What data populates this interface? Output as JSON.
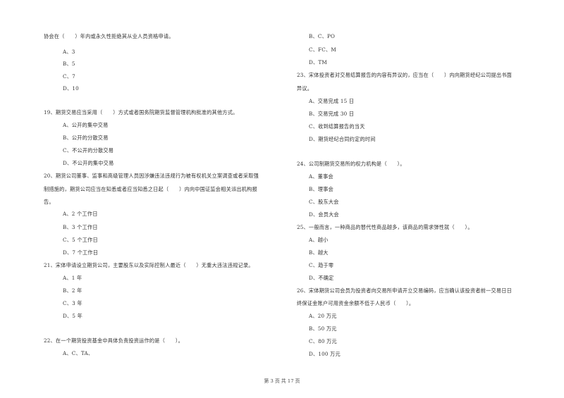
{
  "left_column": {
    "q18_tail": {
      "stem": "协会在（　　）年内或永久性拒绝其从业人员资格申请。",
      "options": [
        "A、3",
        "B、5",
        "C、7",
        "D、10"
      ]
    },
    "q19": {
      "stem": "19、期货交易应当采用（　　）方式或者国务院期货监督管理机构批准的其他方式。",
      "options": [
        "A、公开的集中交易",
        "B、公开的分散交易",
        "C、不公开的分散交易",
        "D、不公开的集中交易"
      ]
    },
    "q20": {
      "stem_lines": [
        "20、期货公司董事、监事和高级管理人员因涉嫌违法违规行为被有权机关立案调查或者采取强",
        "制措施的，期货公司应当在知悉或者应当知悉之日起（　　）内向中国证监会相关派出机构报",
        "告。"
      ],
      "options": [
        "A、2 个工作日",
        "B、3 个工作日",
        "C、5 个工作日",
        "D、7 个工作日"
      ]
    },
    "q21": {
      "stem": "21、宋体申请设立期货公司，主要股东以及实际控制人最近（　　）无重大违法违规记录。",
      "options": [
        "A、1 年",
        "B、2 年",
        "C、3 年",
        "D、5 年"
      ]
    },
    "q22": {
      "stem": "22、在一个期货投资基金中具体负责投资运作的是（　　）。",
      "options": [
        "A、C、TA、"
      ]
    }
  },
  "right_column": {
    "q22_cont": {
      "options": [
        "B、C、PO",
        "C、FC、M",
        "D、TM"
      ]
    },
    "q23": {
      "stem_lines": [
        "23、宋体投资者对交易结算报告的内容有异议的，应当在（　　）内向期货经纪公司提出书面",
        "异议。"
      ],
      "options": [
        "A、交易完成 15 日",
        "B、交易完成 30 日",
        "C、收到结算报告的当天",
        "D、期货经纪合同约定的时间"
      ]
    },
    "q24": {
      "stem": "24、公司制期货交易所的权力机构是（　　）。",
      "options": [
        "A、董事会",
        "B、理事会",
        "C、股东大会",
        "D、会员大会"
      ]
    },
    "q25": {
      "stem": "25、一般而言，一种商品的替代性商品越多，该商品的需求弹性就（　　）。",
      "options": [
        "A、越小",
        "B、越大",
        "C、趋于零",
        "D、不确定"
      ]
    },
    "q26": {
      "stem_lines": [
        "26、宋体期货公司会员为投资者向交易所申请开立交易编码，应当确认该投资者前一交易日日",
        "终保证金账户可用资金余额不低于人民币（　　）。"
      ],
      "options": [
        "A、20 万元",
        "B、50 万元",
        "C、80 万元",
        "D、100 万元"
      ]
    }
  },
  "footer": {
    "page_label": "第 3 页 共 17 页"
  }
}
